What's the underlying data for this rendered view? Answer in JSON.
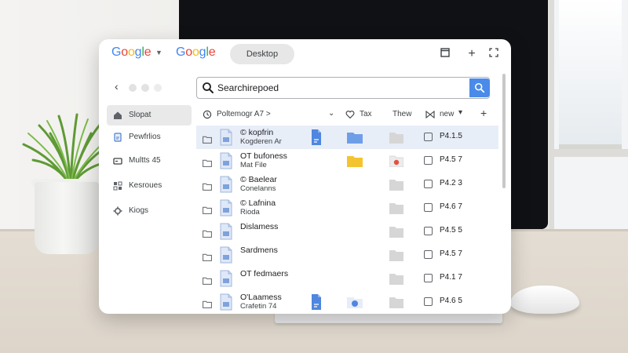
{
  "colors": {
    "google_blue": "#4285F4",
    "google_red": "#EA4335",
    "google_yellow": "#FBBC05",
    "google_green": "#34A853",
    "accent": "#4a8ae8",
    "selected_row": "#e8eef8"
  },
  "header": {
    "brand_left": "Google",
    "brand_right": "Google",
    "tab_label": "Desktop"
  },
  "search": {
    "value": "Searchirepoed"
  },
  "sidebar": {
    "items": [
      {
        "label": "Slopat",
        "icon": "home-icon"
      },
      {
        "label": "Pewfrlios",
        "icon": "document-icon"
      },
      {
        "label": "Multts 45",
        "icon": "drive-icon"
      },
      {
        "label": "Kesroues",
        "icon": "grid-icon"
      },
      {
        "label": "Kiogs",
        "icon": "gear-icon"
      }
    ]
  },
  "list_header": {
    "name": "Poltemogr A7 >",
    "tax": "Tax",
    "thew": "Thew",
    "new": "new"
  },
  "rows": [
    {
      "line1": "© kopfrin",
      "line2": "Kogderen Ar",
      "size": "P4.1.5",
      "selected": true
    },
    {
      "line1": "OT bufoness",
      "line2": "Mat File",
      "size": "P4.5 7",
      "selected": false
    },
    {
      "line1": "© Baelear",
      "line2": "Conelanns",
      "size": "P4.2 3",
      "selected": false
    },
    {
      "line1": "© Lafnina",
      "line2": "Rioda",
      "size": "P4.6 7",
      "selected": false
    },
    {
      "line1": "Dislamess",
      "line2": "",
      "size": "P4.5 5",
      "selected": false
    },
    {
      "line1": "Sardmens",
      "line2": "",
      "size": "P4.5 7",
      "selected": false
    },
    {
      "line1": "OT fedmaers",
      "line2": "",
      "size": "P4.1 7",
      "selected": false
    },
    {
      "line1": "O'Laamess",
      "line2": "Crafetin 74",
      "size": "P4.6 5",
      "selected": false
    }
  ]
}
